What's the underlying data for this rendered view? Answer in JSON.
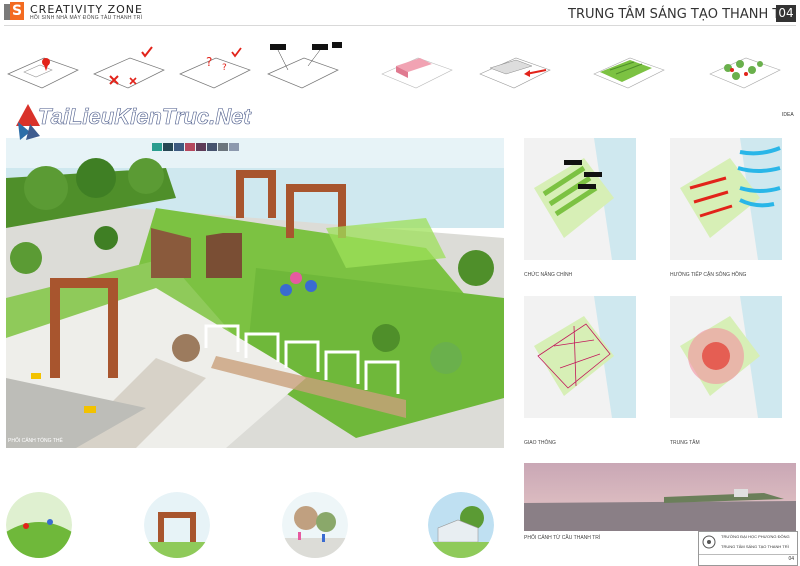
{
  "header": {
    "brand_name": "CREATIVITY ZONE",
    "logo_letter": "S",
    "subtitle": "HỒI SINH NHÀ MÁY ĐÓNG TÀU THANH TRÌ",
    "title": "TRUNG TÂM SÁNG TẠO THANH TRÌ",
    "page_number": "04"
  },
  "colors": {
    "accent_orange": "#f36b21",
    "header_grey": "#333333",
    "grass": "#7cc242",
    "water": "#cfe8ef",
    "rust": "#a8552e"
  },
  "concept_strip": {
    "label": "IDEA",
    "icons": [
      "site-analysis-pin-icon",
      "check-cross-icon",
      "question-icon",
      "annotated-site-icon",
      "pink-blocks-icon",
      "arrow-flow-icon",
      "green-terrace-icon",
      "tree-grid-icon"
    ]
  },
  "watermark": "TaiLieuKienTruc.Net",
  "main_render": {
    "caption": "PHỐI CẢNH TỔNG THỂ"
  },
  "maps": [
    {
      "caption": "CHỨC NĂNG CHÍNH"
    },
    {
      "caption": "HƯỚNG TIẾP CẬN SÔNG HỒNG"
    },
    {
      "caption": "GIAO THÔNG"
    },
    {
      "caption": "TRUNG TÂM"
    }
  ],
  "river_view": {
    "caption": "PHỐI CẢNH TỪ CẦU THANH TRÌ"
  },
  "title_block": {
    "school": "TRƯỜNG ĐẠI HỌC PHƯƠNG ĐÔNG",
    "project": "TRUNG TÂM SÁNG TẠO THANH TRÌ",
    "sheet": "04"
  }
}
